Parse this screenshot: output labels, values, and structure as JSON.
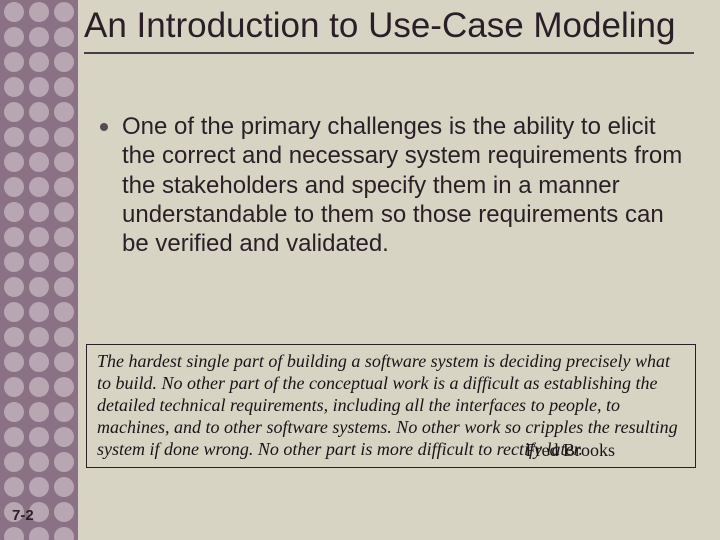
{
  "slide": {
    "title": "An Introduction to Use-Case Modeling",
    "bullets": [
      "One of the primary challenges is the ability to elicit the correct and necessary system requirements from the stakeholders and specify them in a manner understandable to them so those requirements can be verified and validated."
    ],
    "quote": {
      "text": "The hardest single part of building a software system is deciding precisely what to build. No other part of the conceptual work is a difficult as establishing the detailed technical requirements, including all the interfaces to people, to machines, and to other software systems. No other work so cripples the resulting system if done wrong. No other part is more difficult to rectify later.",
      "attribution": "Fred Brooks"
    },
    "page_number": "7-2"
  },
  "theme": {
    "accent": "#8a7183",
    "background": "#d7d4c4"
  }
}
